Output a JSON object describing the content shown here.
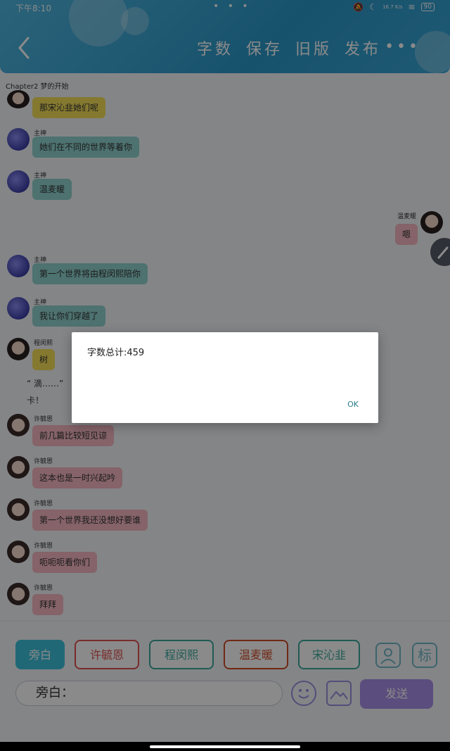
{
  "status_bar": {
    "time": "下午8:10",
    "dots": "• • •",
    "battery": "90",
    "speed": "16.7 K/s"
  },
  "header": {
    "actions": [
      "字数",
      "保存",
      "旧版",
      "发布"
    ],
    "more": "•••"
  },
  "chapter_title": "Chapter2 梦的开始",
  "messages": [
    {
      "name": "",
      "text": "那宋沁韭她们呢",
      "color": "yellow"
    },
    {
      "name": "主神",
      "text": "她们在不同的世界等着你",
      "color": "teal"
    },
    {
      "name": "主神",
      "text": "温麦暖",
      "color": "teal"
    },
    {
      "name": "温麦暖",
      "text": "嗯",
      "color": "pink"
    },
    {
      "name": "主神",
      "text": "第一个世界将由程闵熙陪你",
      "color": "teal"
    },
    {
      "name": "主神",
      "text": "我让你们穿越了",
      "color": "teal"
    },
    {
      "name": "程闵熙",
      "text": "树",
      "color": "yellow"
    },
    {
      "name": "",
      "text": "“ 滴……”",
      "color": "none"
    },
    {
      "name": "",
      "text": "卡！",
      "color": "none"
    },
    {
      "name": "许毓恩",
      "text": "前几篇比较短见谅",
      "color": "pink"
    },
    {
      "name": "许毓恩",
      "text": "这本也是一时兴起吟",
      "color": "pink"
    },
    {
      "name": "许毓恩",
      "text": "第一个世界我还没想好要谁",
      "color": "pink"
    },
    {
      "name": "许毓恩",
      "text": "呃呃呃看你们",
      "color": "pink"
    },
    {
      "name": "许毓恩",
      "text": "拜拜",
      "color": "pink"
    }
  ],
  "characters": [
    {
      "label": "旁白",
      "color": "#3ec0dd"
    },
    {
      "label": "许毓恩",
      "color": "#e05050"
    },
    {
      "label": "程闵熙",
      "color": "#3aa89a"
    },
    {
      "label": "温麦暖",
      "color": "#d04a2a"
    },
    {
      "label": "宋沁韭",
      "color": "#3aa89a"
    }
  ],
  "side_buttons": {
    "mark": "标"
  },
  "input": {
    "value": "旁白："
  },
  "send_label": "发送",
  "dialog": {
    "message": "字数总计:459",
    "ok_label": "OK"
  }
}
